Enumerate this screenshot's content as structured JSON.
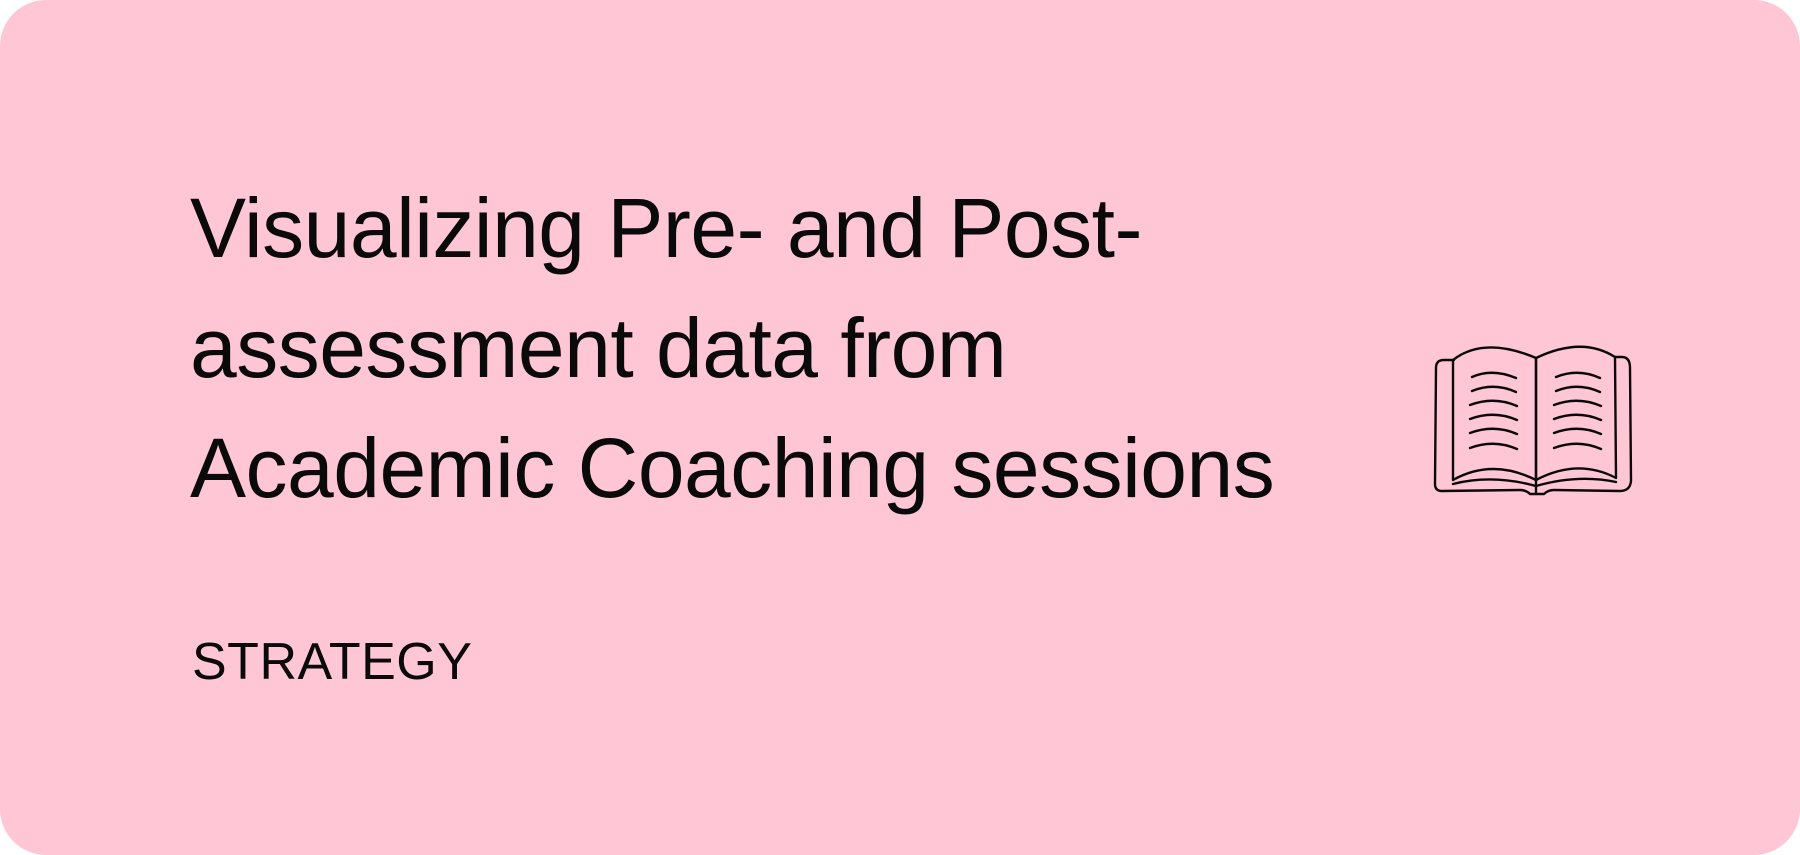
{
  "card": {
    "title_lines": [
      "Visualizing Pre- and Post-",
      "assessment data from",
      "Academic Coaching sessions"
    ],
    "category": "STRATEGY",
    "icon": "open-book-icon",
    "background_color": "#ffc6d5",
    "text_color": "#0a0a0a"
  }
}
